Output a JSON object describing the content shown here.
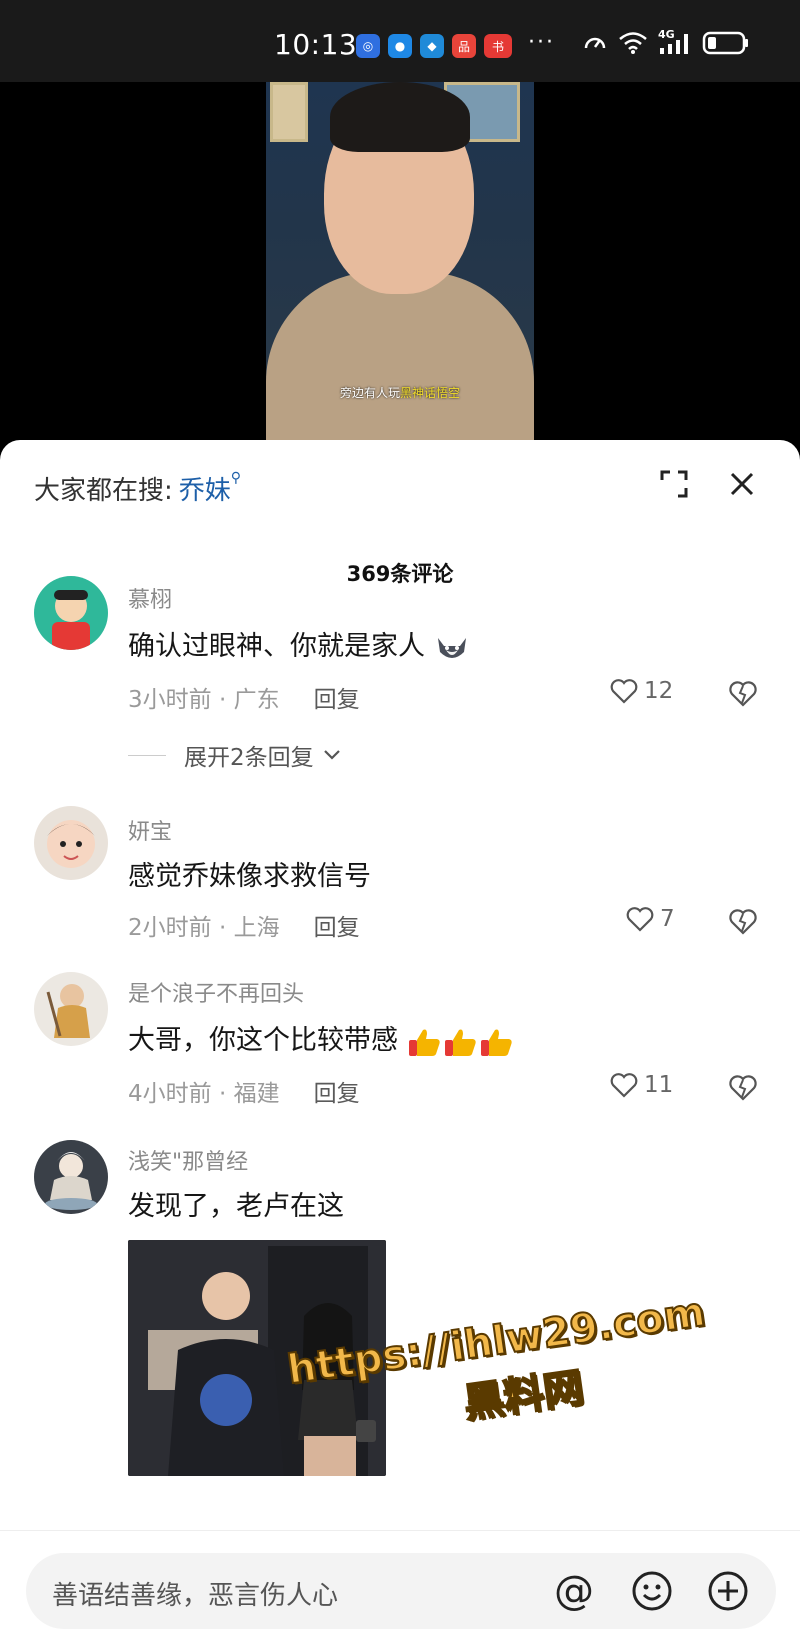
{
  "status_bar": {
    "time": "10:13",
    "more": "···",
    "network": "4G",
    "icons": [
      "speed-icon",
      "wifi-icon",
      "signal-icon",
      "battery-icon"
    ]
  },
  "video": {
    "subtitle_plain": "旁边有人玩",
    "subtitle_highlight": "黑神话悟空"
  },
  "sheet": {
    "search_hint_label": "大家都在搜:",
    "search_keyword": "乔妹",
    "comment_count": "369条评论"
  },
  "comments": [
    {
      "name": "慕栩",
      "text": "确认过眼神、你就是家人",
      "time": "3小时前",
      "location": "广东",
      "reply": "回复",
      "likes": "12",
      "expand": "展开2条回复"
    },
    {
      "name": "妍宝",
      "text": "感觉乔妹像求救信号",
      "time": "2小时前",
      "location": "上海",
      "reply": "回复",
      "likes": "7"
    },
    {
      "name": "是个浪子不再回头",
      "text": "大哥，你这个比较带感",
      "time": "4小时前",
      "location": "福建",
      "reply": "回复",
      "likes": "11"
    },
    {
      "name": "浅笑\"那曾经",
      "text": "发现了，老卢在这"
    }
  ],
  "watermark": {
    "url": "https://ihlw29.com",
    "name": "黑料网"
  },
  "input_bar": {
    "placeholder": "善语结善缘，恶言伤人心",
    "at_symbol": "@"
  },
  "colors": {
    "accent_blue": "#1d5fa8",
    "subtitle_yellow": "#f0dc2a",
    "watermark": "#f2b84a"
  }
}
